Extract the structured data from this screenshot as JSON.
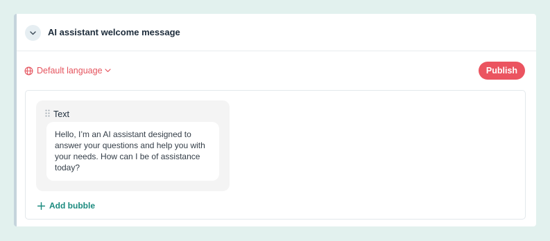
{
  "section": {
    "title": "AI assistant welcome message"
  },
  "language": {
    "label": "Default language"
  },
  "toolbar": {
    "publish_label": "Publish"
  },
  "bubble_group": {
    "label": "Text",
    "message": "Hello, I’m an AI assistant designed to answer your questions and help you with your needs. How can I be of assistance today?"
  },
  "add_bubble": {
    "label": "Add bubble"
  },
  "icons": {
    "collapse": "chevron-down-icon",
    "language": "globe-icon",
    "language_dropdown": "chevron-down-icon",
    "drag": "drag-handle-icon",
    "add": "plus-icon"
  },
  "colors": {
    "background": "#e2f1ee",
    "accent": "#eb5460",
    "language_text": "#e5535d",
    "add_bubble": "#1a8a7e",
    "card_border": "#c5d4dc"
  }
}
